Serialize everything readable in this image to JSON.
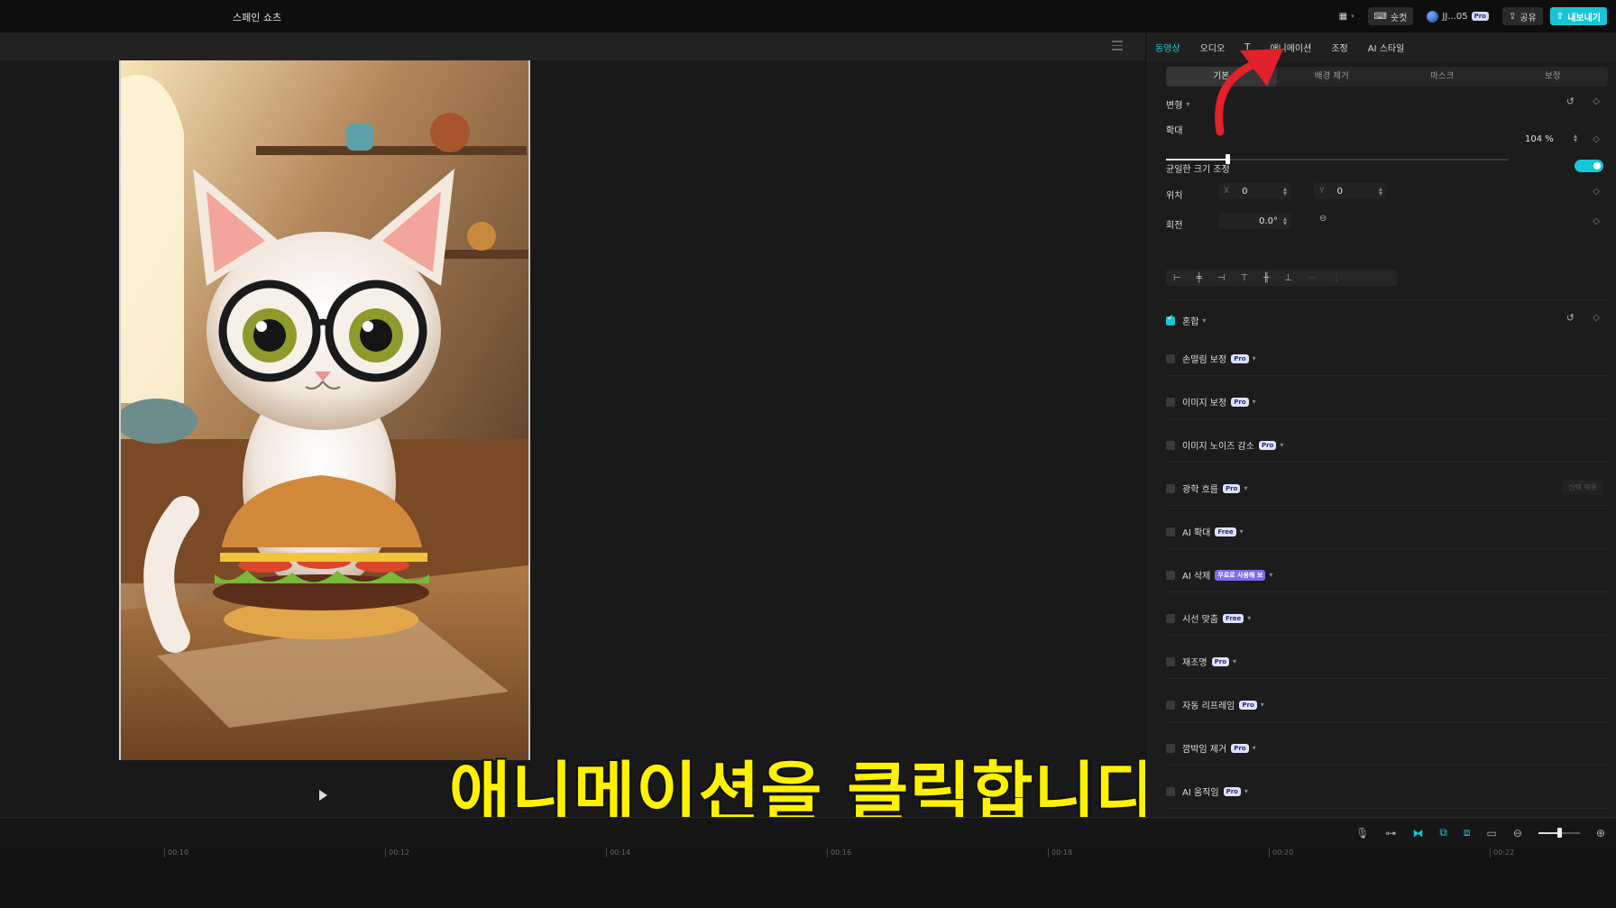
{
  "project_title": "스페인 쇼츠",
  "topbar": {
    "shortcut_label": "숏컷",
    "user_label": "JJ...05",
    "user_badge": "Pro",
    "share_label": "공유",
    "export_label": "내보내기"
  },
  "panel": {
    "tabs": [
      {
        "label": "동영상",
        "active": true
      },
      {
        "label": "오디오",
        "active": false
      },
      {
        "label": "T",
        "active": false
      },
      {
        "label": "애니메이션",
        "active": false
      },
      {
        "label": "조정",
        "active": false
      },
      {
        "label": "AI 스타일",
        "active": false
      }
    ],
    "subtabs": [
      {
        "label": "기본",
        "active": true
      },
      {
        "label": "배경 제거",
        "active": false
      },
      {
        "label": "마스크",
        "active": false
      },
      {
        "label": "보정",
        "active": false
      }
    ],
    "transform_label": "변형",
    "scale_label": "확대",
    "scale_value": "104 %",
    "scale_fraction": 0.18,
    "uniform_scale_label": "균일한 크기 조정",
    "position_label": "위치",
    "pos_x_label": "X",
    "pos_x_value": "0",
    "pos_y_label": "Y",
    "pos_y_value": "0",
    "rotation_label": "회전",
    "rotation_value": "0.0°",
    "blend_label": "혼합",
    "features": [
      {
        "label": "손떨림 보정",
        "badge": "Pro"
      },
      {
        "label": "이미지 보정",
        "badge": "Pro"
      },
      {
        "label": "이미지 노이즈 감소",
        "badge": "Pro"
      },
      {
        "label": "광학 흐름",
        "badge": "Pro"
      },
      {
        "label": "AI 확대",
        "badge": "Free"
      },
      {
        "label": "AI 삭제",
        "badge": "무료로 사용해 보"
      },
      {
        "label": "시선 맞춤",
        "badge": "Free"
      },
      {
        "label": "재조명",
        "badge": "Pro"
      },
      {
        "label": "자동 리프레임",
        "badge": "Pro"
      },
      {
        "label": "깜박임 제거",
        "badge": "Pro"
      },
      {
        "label": "AI 움직임",
        "badge": "Pro"
      }
    ],
    "optical_flow_button": "선택 적용"
  },
  "subtitle": "애니메이션을 클릭합니다",
  "timeline": {
    "zoom_fraction": 0.5,
    "ticks": [
      "00:10",
      "00:12",
      "00:14",
      "00:16",
      "00:18",
      "00:20",
      "00:22"
    ]
  },
  "colors": {
    "accent": "#17c6d6",
    "annotation_arrow": "#e0202a",
    "subtitle": "#fff200"
  }
}
